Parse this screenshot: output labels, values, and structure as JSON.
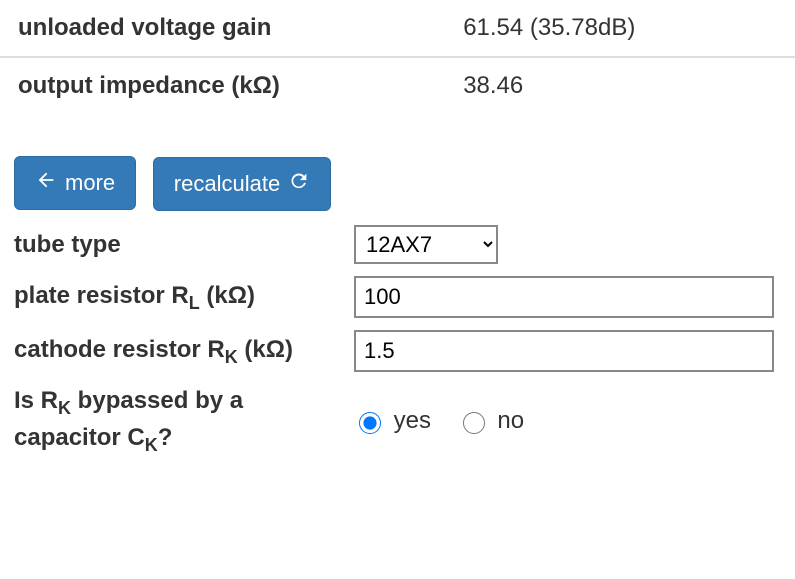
{
  "results": {
    "gain_label": "unloaded voltage gain",
    "gain_value": "61.54 (35.78dB)",
    "zout_label": "output impedance (kΩ)",
    "zout_value": "38.46"
  },
  "buttons": {
    "more_label": "more",
    "recalc_label": "recalculate"
  },
  "form": {
    "tube_type_label": "tube type",
    "tube_type_value": "12AX7",
    "plate_resistor_label_pre": "plate resistor R",
    "plate_resistor_label_sub": "L",
    "plate_resistor_label_post": " (kΩ)",
    "plate_resistor_value": "100",
    "cathode_resistor_label_pre": "cathode resistor R",
    "cathode_resistor_label_sub": "K",
    "cathode_resistor_label_post": " (kΩ)",
    "cathode_resistor_value": "1.5",
    "bypass_label_1_pre": "Is R",
    "bypass_label_1_sub": "K",
    "bypass_label_1_post": " bypassed by a",
    "bypass_label_2_pre": "capacitor C",
    "bypass_label_2_sub": "K",
    "bypass_label_2_post": "?",
    "bypass_yes": "yes",
    "bypass_no": "no",
    "bypass_selected": "yes"
  }
}
